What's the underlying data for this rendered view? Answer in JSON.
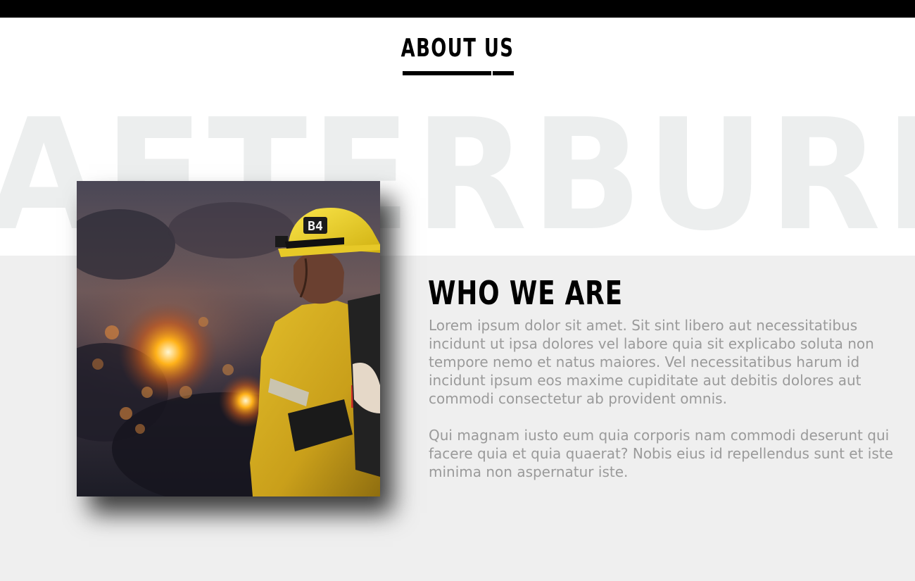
{
  "section": {
    "title": "ABOUT US"
  },
  "watermark": {
    "text": "AFTERBURNER"
  },
  "about": {
    "heading": "WHO WE ARE",
    "paragraphs": [
      "Lorem ipsum dolor sit amet. Sit sint libero aut necessitatibus incidunt ut ipsa dolores vel labore quia sit explicabo soluta non tempore nemo et natus maiores. Vel necessitatibus harum id incidunt ipsum eos maxime cupiditate aut debitis dolores aut commodi consectetur ab provident omnis.",
      "Qui magnam iusto eum quia corporis nam commodi deserunt qui facere quia et quia quaerat? Nobis eius id repellendus sunt et iste minima non aspernatur iste."
    ],
    "image": {
      "helmet_badge": "B4"
    }
  },
  "colors": {
    "top_bar": "#000000",
    "band_background": "#efefef",
    "watermark": "#eceeee",
    "heading": "#000000",
    "body_text": "#9a9a9a",
    "helmet": "#f2d21a",
    "jacket": "#d8b21e"
  }
}
